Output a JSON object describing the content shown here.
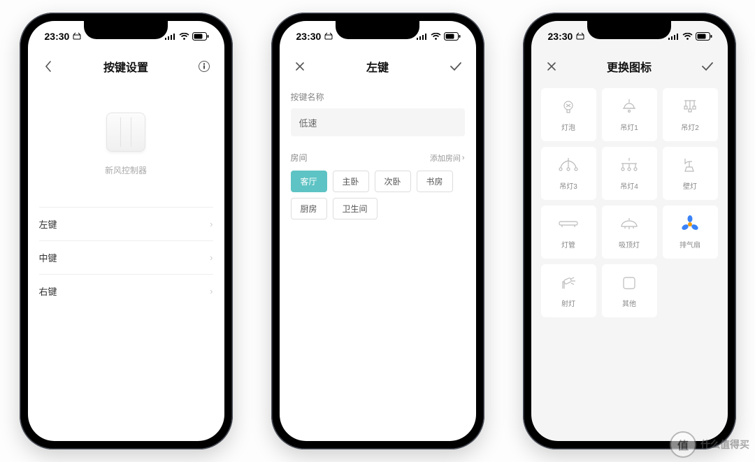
{
  "status": {
    "time": "23:30"
  },
  "phone1": {
    "title": "按键设置",
    "device_name": "新风控制器",
    "rows": [
      "左键",
      "中键",
      "右键"
    ]
  },
  "phone2": {
    "title": "左键",
    "field_label": "按键名称",
    "field_value": "低速",
    "room_label": "房间",
    "add_room": "添加房间",
    "rooms": [
      "客厅",
      "主卧",
      "次卧",
      "书房",
      "厨房",
      "卫生间"
    ],
    "room_selected": "客厅"
  },
  "phone3": {
    "title": "更换图标",
    "icons": [
      {
        "id": "bulb",
        "label": "灯泡"
      },
      {
        "id": "pendant1",
        "label": "吊灯1"
      },
      {
        "id": "pendant2",
        "label": "吊灯2"
      },
      {
        "id": "pendant3",
        "label": "吊灯3"
      },
      {
        "id": "pendant4",
        "label": "吊灯4"
      },
      {
        "id": "wall",
        "label": "壁灯"
      },
      {
        "id": "tube",
        "label": "灯管"
      },
      {
        "id": "ceiling",
        "label": "吸顶灯"
      },
      {
        "id": "fan",
        "label": "排气扇",
        "selected": true
      },
      {
        "id": "spot",
        "label": "射灯"
      },
      {
        "id": "other",
        "label": "其他"
      }
    ]
  },
  "watermark": "什么值得买"
}
